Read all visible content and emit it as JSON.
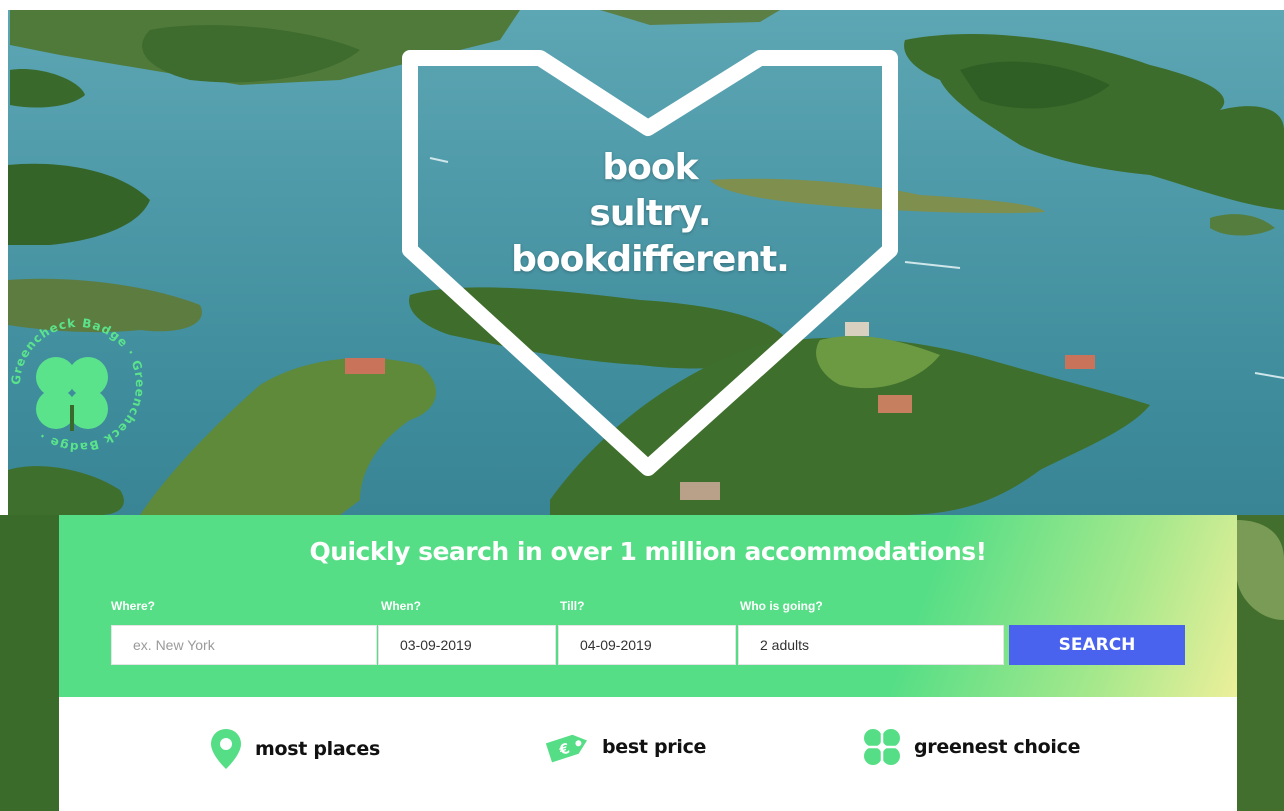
{
  "hero": {
    "headline_line1": "book",
    "headline_line2": "sultry.",
    "headline_line3": "bookdifferent.",
    "badge_text": "Greencheck Badge · Greencheck Badge ·"
  },
  "search": {
    "title": "Quickly search in over 1 million accommodations!",
    "where_label": "Where?",
    "where_placeholder": "ex. New York",
    "when_label": "When?",
    "when_value": "03-09-2019",
    "till_label": "Till?",
    "till_value": "04-09-2019",
    "who_label": "Who is going?",
    "who_value": "2 adults",
    "button_label": "SEARCH"
  },
  "features": [
    {
      "label": "most places",
      "icon": "map-pin-icon"
    },
    {
      "label": "best price",
      "icon": "euro-tag-icon"
    },
    {
      "label": "greenest choice",
      "icon": "clover-icon"
    }
  ],
  "colors": {
    "brand_green": "#56de86",
    "button_blue": "#4a63ee",
    "water": "#3f8f9f"
  }
}
